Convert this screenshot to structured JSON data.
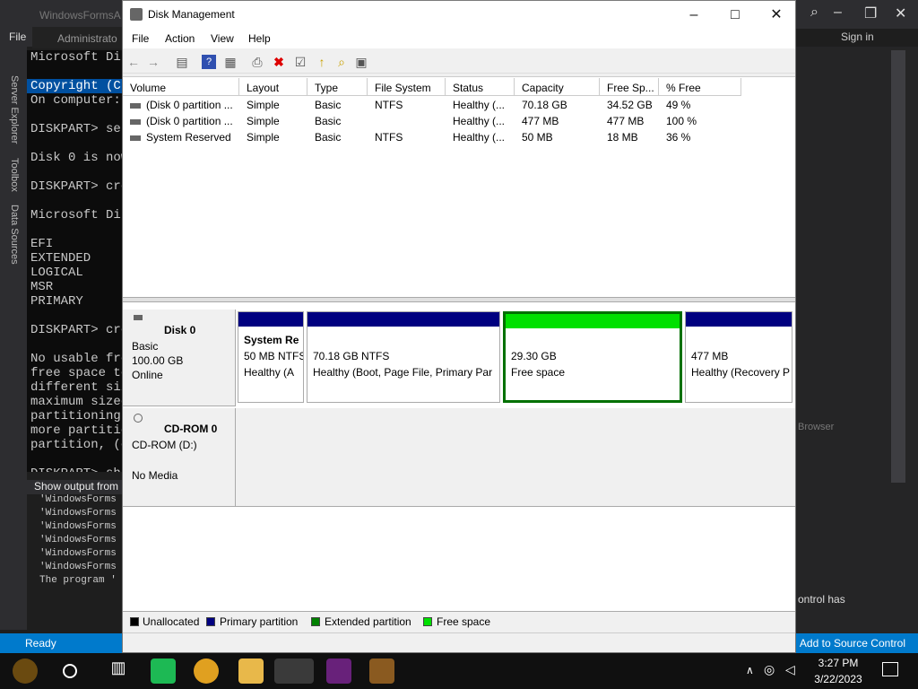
{
  "vs": {
    "title": "WindowsFormsA",
    "menu_file": "File",
    "admin_tab": "Administrato",
    "side_tabs": [
      "Server Explorer",
      "Toolbox",
      "Data Sources"
    ],
    "console_lines": [
      "Microsoft Dis",
      "",
      "Copyright (C)",
      "On computer:",
      "",
      "DISKPART> sel",
      "",
      "Disk 0 is now",
      "",
      "DISKPART> cre",
      "",
      "Microsoft Dis",
      "",
      "EFI",
      "EXTENDED",
      "LOGICAL",
      "MSR",
      "PRIMARY",
      "",
      "DISKPART> cre",
      "",
      "No usable fre",
      "free space to",
      "different siz",
      "maximum sized",
      "partitioning",
      "more partitio",
      "partition, (c",
      "",
      "DISKPART> shu"
    ],
    "output_header": "Show output from",
    "output_lines": [
      "'WindowsForms",
      "'WindowsForms",
      "'WindowsForms",
      "'WindowsForms",
      "'WindowsForms",
      "'WindowsForms",
      "The program '"
    ],
    "status_left": "Ready",
    "status_right": "Add to Source Control",
    "sign_in": "Sign in",
    "right_text": "ontrol has",
    "browser_text": "Browser"
  },
  "dm": {
    "title": "Disk Management",
    "menu": [
      "File",
      "Action",
      "View",
      "Help"
    ],
    "columns": [
      "Volume",
      "Layout",
      "Type",
      "File System",
      "Status",
      "Capacity",
      "Free Sp...",
      "% Free"
    ],
    "rows": [
      [
        "(Disk 0 partition ...",
        "Simple",
        "Basic",
        "NTFS",
        "Healthy (...",
        "70.18 GB",
        "34.52 GB",
        "49 %"
      ],
      [
        "(Disk 0 partition ...",
        "Simple",
        "Basic",
        "",
        "Healthy (...",
        "477 MB",
        "477 MB",
        "100 %"
      ],
      [
        "System Reserved",
        "Simple",
        "Basic",
        "NTFS",
        "Healthy (...",
        "50 MB",
        "18 MB",
        "36 %"
      ]
    ],
    "disk0": {
      "name": "Disk 0",
      "type": "Basic",
      "size": "100.00 GB",
      "state": "Online"
    },
    "cdrom": {
      "name": "CD-ROM 0",
      "drive": "CD-ROM (D:)",
      "media": "No Media"
    },
    "partitions": [
      {
        "name": "System Re",
        "size": "50 MB NTFS",
        "status": "Healthy (A"
      },
      {
        "name": "",
        "size": "70.18 GB NTFS",
        "status": "Healthy (Boot, Page File, Primary Par"
      },
      {
        "name": "",
        "size": "29.30 GB",
        "status": "Free space"
      },
      {
        "name": "",
        "size": "477 MB",
        "status": "Healthy (Recovery P"
      }
    ],
    "legend": [
      "Unallocated",
      "Primary partition",
      "Extended partition",
      "Free space"
    ],
    "colors": {
      "unallocated": "#000000",
      "primary": "#000080",
      "extended": "#008000",
      "free": "#00e000"
    }
  },
  "taskbar": {
    "time": "3:27 PM",
    "date": "3/22/2023"
  }
}
